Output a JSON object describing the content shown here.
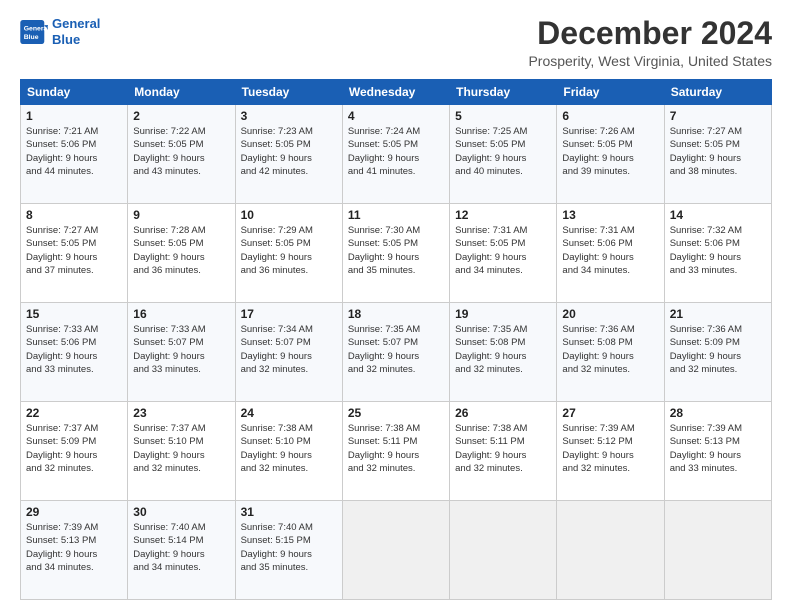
{
  "header": {
    "logo_line1": "General",
    "logo_line2": "Blue",
    "title": "December 2024",
    "subtitle": "Prosperity, West Virginia, United States"
  },
  "columns": [
    "Sunday",
    "Monday",
    "Tuesday",
    "Wednesday",
    "Thursday",
    "Friday",
    "Saturday"
  ],
  "weeks": [
    [
      {
        "day": "1",
        "lines": [
          "Sunrise: 7:21 AM",
          "Sunset: 5:06 PM",
          "Daylight: 9 hours",
          "and 44 minutes."
        ]
      },
      {
        "day": "2",
        "lines": [
          "Sunrise: 7:22 AM",
          "Sunset: 5:05 PM",
          "Daylight: 9 hours",
          "and 43 minutes."
        ]
      },
      {
        "day": "3",
        "lines": [
          "Sunrise: 7:23 AM",
          "Sunset: 5:05 PM",
          "Daylight: 9 hours",
          "and 42 minutes."
        ]
      },
      {
        "day": "4",
        "lines": [
          "Sunrise: 7:24 AM",
          "Sunset: 5:05 PM",
          "Daylight: 9 hours",
          "and 41 minutes."
        ]
      },
      {
        "day": "5",
        "lines": [
          "Sunrise: 7:25 AM",
          "Sunset: 5:05 PM",
          "Daylight: 9 hours",
          "and 40 minutes."
        ]
      },
      {
        "day": "6",
        "lines": [
          "Sunrise: 7:26 AM",
          "Sunset: 5:05 PM",
          "Daylight: 9 hours",
          "and 39 minutes."
        ]
      },
      {
        "day": "7",
        "lines": [
          "Sunrise: 7:27 AM",
          "Sunset: 5:05 PM",
          "Daylight: 9 hours",
          "and 38 minutes."
        ]
      }
    ],
    [
      {
        "day": "8",
        "lines": [
          "Sunrise: 7:27 AM",
          "Sunset: 5:05 PM",
          "Daylight: 9 hours",
          "and 37 minutes."
        ]
      },
      {
        "day": "9",
        "lines": [
          "Sunrise: 7:28 AM",
          "Sunset: 5:05 PM",
          "Daylight: 9 hours",
          "and 36 minutes."
        ]
      },
      {
        "day": "10",
        "lines": [
          "Sunrise: 7:29 AM",
          "Sunset: 5:05 PM",
          "Daylight: 9 hours",
          "and 36 minutes."
        ]
      },
      {
        "day": "11",
        "lines": [
          "Sunrise: 7:30 AM",
          "Sunset: 5:05 PM",
          "Daylight: 9 hours",
          "and 35 minutes."
        ]
      },
      {
        "day": "12",
        "lines": [
          "Sunrise: 7:31 AM",
          "Sunset: 5:05 PM",
          "Daylight: 9 hours",
          "and 34 minutes."
        ]
      },
      {
        "day": "13",
        "lines": [
          "Sunrise: 7:31 AM",
          "Sunset: 5:06 PM",
          "Daylight: 9 hours",
          "and 34 minutes."
        ]
      },
      {
        "day": "14",
        "lines": [
          "Sunrise: 7:32 AM",
          "Sunset: 5:06 PM",
          "Daylight: 9 hours",
          "and 33 minutes."
        ]
      }
    ],
    [
      {
        "day": "15",
        "lines": [
          "Sunrise: 7:33 AM",
          "Sunset: 5:06 PM",
          "Daylight: 9 hours",
          "and 33 minutes."
        ]
      },
      {
        "day": "16",
        "lines": [
          "Sunrise: 7:33 AM",
          "Sunset: 5:07 PM",
          "Daylight: 9 hours",
          "and 33 minutes."
        ]
      },
      {
        "day": "17",
        "lines": [
          "Sunrise: 7:34 AM",
          "Sunset: 5:07 PM",
          "Daylight: 9 hours",
          "and 32 minutes."
        ]
      },
      {
        "day": "18",
        "lines": [
          "Sunrise: 7:35 AM",
          "Sunset: 5:07 PM",
          "Daylight: 9 hours",
          "and 32 minutes."
        ]
      },
      {
        "day": "19",
        "lines": [
          "Sunrise: 7:35 AM",
          "Sunset: 5:08 PM",
          "Daylight: 9 hours",
          "and 32 minutes."
        ]
      },
      {
        "day": "20",
        "lines": [
          "Sunrise: 7:36 AM",
          "Sunset: 5:08 PM",
          "Daylight: 9 hours",
          "and 32 minutes."
        ]
      },
      {
        "day": "21",
        "lines": [
          "Sunrise: 7:36 AM",
          "Sunset: 5:09 PM",
          "Daylight: 9 hours",
          "and 32 minutes."
        ]
      }
    ],
    [
      {
        "day": "22",
        "lines": [
          "Sunrise: 7:37 AM",
          "Sunset: 5:09 PM",
          "Daylight: 9 hours",
          "and 32 minutes."
        ]
      },
      {
        "day": "23",
        "lines": [
          "Sunrise: 7:37 AM",
          "Sunset: 5:10 PM",
          "Daylight: 9 hours",
          "and 32 minutes."
        ]
      },
      {
        "day": "24",
        "lines": [
          "Sunrise: 7:38 AM",
          "Sunset: 5:10 PM",
          "Daylight: 9 hours",
          "and 32 minutes."
        ]
      },
      {
        "day": "25",
        "lines": [
          "Sunrise: 7:38 AM",
          "Sunset: 5:11 PM",
          "Daylight: 9 hours",
          "and 32 minutes."
        ]
      },
      {
        "day": "26",
        "lines": [
          "Sunrise: 7:38 AM",
          "Sunset: 5:11 PM",
          "Daylight: 9 hours",
          "and 32 minutes."
        ]
      },
      {
        "day": "27",
        "lines": [
          "Sunrise: 7:39 AM",
          "Sunset: 5:12 PM",
          "Daylight: 9 hours",
          "and 32 minutes."
        ]
      },
      {
        "day": "28",
        "lines": [
          "Sunrise: 7:39 AM",
          "Sunset: 5:13 PM",
          "Daylight: 9 hours",
          "and 33 minutes."
        ]
      }
    ],
    [
      {
        "day": "29",
        "lines": [
          "Sunrise: 7:39 AM",
          "Sunset: 5:13 PM",
          "Daylight: 9 hours",
          "and 34 minutes."
        ]
      },
      {
        "day": "30",
        "lines": [
          "Sunrise: 7:40 AM",
          "Sunset: 5:14 PM",
          "Daylight: 9 hours",
          "and 34 minutes."
        ]
      },
      {
        "day": "31",
        "lines": [
          "Sunrise: 7:40 AM",
          "Sunset: 5:15 PM",
          "Daylight: 9 hours",
          "and 35 minutes."
        ]
      },
      null,
      null,
      null,
      null
    ]
  ]
}
